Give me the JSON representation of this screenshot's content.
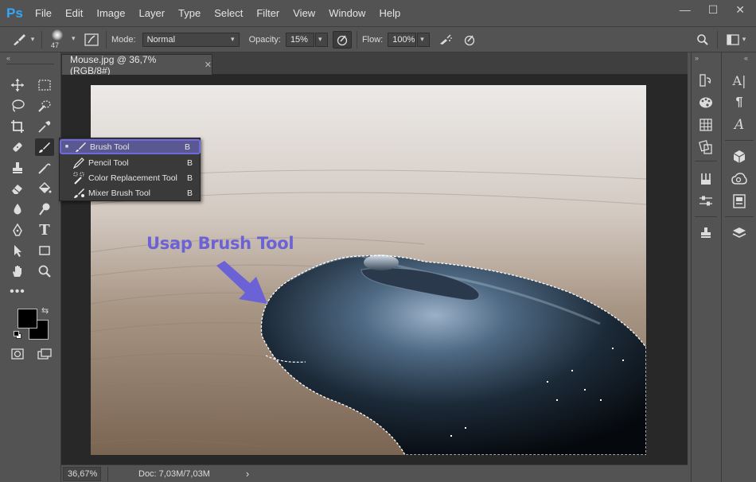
{
  "app": {
    "logo": "Ps"
  },
  "menu": [
    "File",
    "Edit",
    "Image",
    "Layer",
    "Type",
    "Select",
    "Filter",
    "View",
    "Window",
    "Help"
  ],
  "window_controls": {
    "minimize": "—",
    "maximize": "☐",
    "close": "✕"
  },
  "options": {
    "brush_size": "47",
    "mode_label": "Mode:",
    "mode_value": "Normal",
    "opacity_label": "Opacity:",
    "opacity_value": "15%",
    "flow_label": "Flow:",
    "flow_value": "100%"
  },
  "document_tab": {
    "title": "Mouse.jpg @ 36,7% (RGB/8#)",
    "close": "✕"
  },
  "status": {
    "zoom": "36,67%",
    "doc": "Doc: 7,03M/7,03M",
    "arrow": "›"
  },
  "flyout": {
    "items": [
      {
        "label": "Brush Tool",
        "key": "B",
        "icon": "brush-icon",
        "selected": true
      },
      {
        "label": "Pencil Tool",
        "key": "B",
        "icon": "pencil-icon",
        "selected": false
      },
      {
        "label": "Color Replacement Tool",
        "key": "B",
        "icon": "color-replacement-icon",
        "selected": false
      },
      {
        "label": "Mixer Brush Tool",
        "key": "B",
        "icon": "mixer-brush-icon",
        "selected": false
      }
    ]
  },
  "annotation": {
    "text": "Usap Brush Tool",
    "color": "#6b62d6"
  },
  "colors": {
    "foreground": "#000000",
    "background": "#000000",
    "selection_accent": "#6f6ae0"
  }
}
